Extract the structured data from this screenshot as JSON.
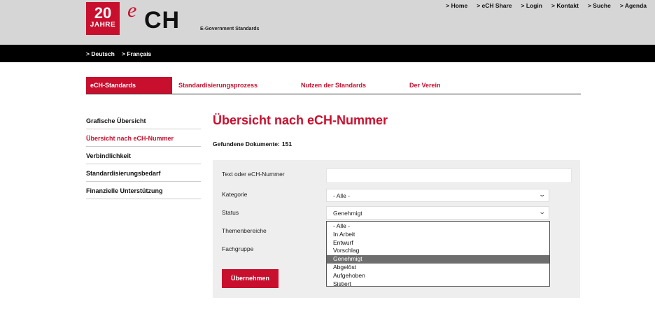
{
  "header": {
    "logo_number": "20",
    "logo_years": "JAHRE",
    "logo_e": "e",
    "logo_ch": "CH",
    "logo_subtitle": "E-Government Standards",
    "topnav": [
      "> Home",
      "> eCH Share",
      "> Login",
      "> Kontakt",
      "> Suche",
      "> Agenda"
    ]
  },
  "languages": [
    "> Deutsch",
    "> Français"
  ],
  "main_tabs": [
    "eCH-Standards",
    "Standardisierungsprozess",
    "Nutzen der Standards",
    "Der Verein"
  ],
  "sidebar": {
    "items": [
      "Grafische Übersicht",
      "Übersicht nach eCH-Nummer",
      "Verbindlichkeit",
      "Standardisierungsbedarf",
      "Finanzielle Unterstützung"
    ],
    "active_index": 1
  },
  "page": {
    "title": "Übersicht nach eCH-Nummer",
    "count_label": "Gefundene Dokumente:",
    "count_value": "151"
  },
  "form": {
    "text_label": "Text oder eCH-Nummer",
    "text_value": "",
    "kategorie_label": "Kategorie",
    "kategorie_value": "- Alle -",
    "status_label": "Status",
    "status_value": "Genehmigt",
    "themenbereiche_label": "Themenbereiche",
    "fachgruppe_label": "Fachgruppe",
    "submit_label": "Übernehmen"
  },
  "status_dropdown": {
    "options": [
      "- Alle -",
      "In Arbeit",
      "Entwurf",
      "Vorschlag",
      "Genehmigt",
      "Abgelöst",
      "Aufgehoben",
      "Sistiert"
    ],
    "highlighted_index": 4
  },
  "colors": {
    "brand_red": "#c8102e",
    "topbar_gray": "#d6d6d6",
    "form_bg": "#eeeeee"
  },
  "icons": {
    "select_arrow": "chevron-down-icon"
  }
}
